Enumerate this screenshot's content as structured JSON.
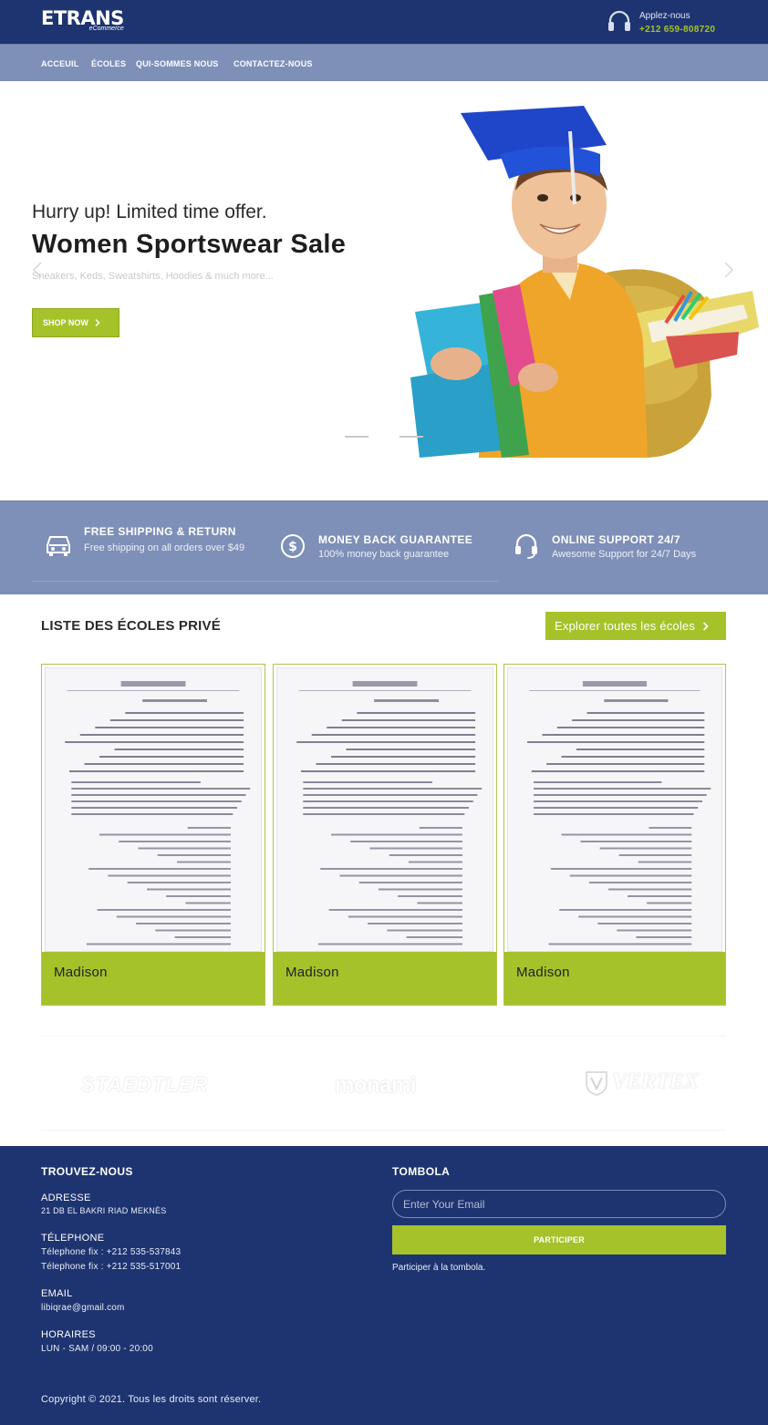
{
  "header": {
    "logo_main": "ETRANS",
    "logo_sub": "eCommerce",
    "call_label": "Applez-nous",
    "call_number": "+212 659-808720"
  },
  "nav": {
    "items": [
      "ACCEUIL",
      "ÉCOLES",
      "QUI-SOMMES NOUS",
      "CONTACTEZ-NOUS"
    ]
  },
  "hero": {
    "kicker": "Hurry up! Limited time offer.",
    "title": "Women Sportswear Sale",
    "description": "Sneakers, Keds, Sweatshirts, Hoodies & much more...",
    "button": "SHOP NOW",
    "slides": 3,
    "active_slide": 2
  },
  "features": [
    {
      "title": "FREE SHIPPING & RETURN",
      "desc": "Free shipping on all orders over $49",
      "icon": "truck-icon"
    },
    {
      "title": "MONEY BACK GUARANTEE",
      "desc": "100% money back guarantee",
      "icon": "dollar-icon"
    },
    {
      "title": "ONLINE SUPPORT 24/7",
      "desc": "Awesome Support for 24/7 Days",
      "icon": "headset-icon"
    }
  ],
  "schools": {
    "title": "LISTE DES ÉCOLES PRIVÉ",
    "explore_button": "Explorer toutes les écoles",
    "cards": [
      {
        "name": "Madison"
      },
      {
        "name": "Madison"
      },
      {
        "name": "Madison"
      }
    ]
  },
  "brands": [
    "STAEDTLER",
    "monami",
    "VERTEX"
  ],
  "footer": {
    "find_title": "TROUVEZ-NOUS",
    "address_label": "ADRESSE",
    "address_value": "21 DB EL BAKRI RIAD MEKNÈS",
    "phone_label": "TÉLEPHONE",
    "phone_1": "Télephone fix : +212 535-537843",
    "phone_2": "Télephone fix : +212 535-517001",
    "email_label": "EMAIL",
    "email_value": "libiqrae@gmail.com",
    "hours_label": "HORAIRES",
    "hours_value": "LUN - SAM / 09:00 - 20:00",
    "tombola_title": "TOMBOLA",
    "email_placeholder": "Enter Your Email",
    "participate_button": "PARTICIPER",
    "participate_note": "Participer à la tombola.",
    "copyright": "Copyright © 2021. Tous les droits sont réserver."
  },
  "colors": {
    "navy": "#1e3470",
    "nav_blue": "#7e8fb8",
    "accent_green": "#a5c22b"
  }
}
